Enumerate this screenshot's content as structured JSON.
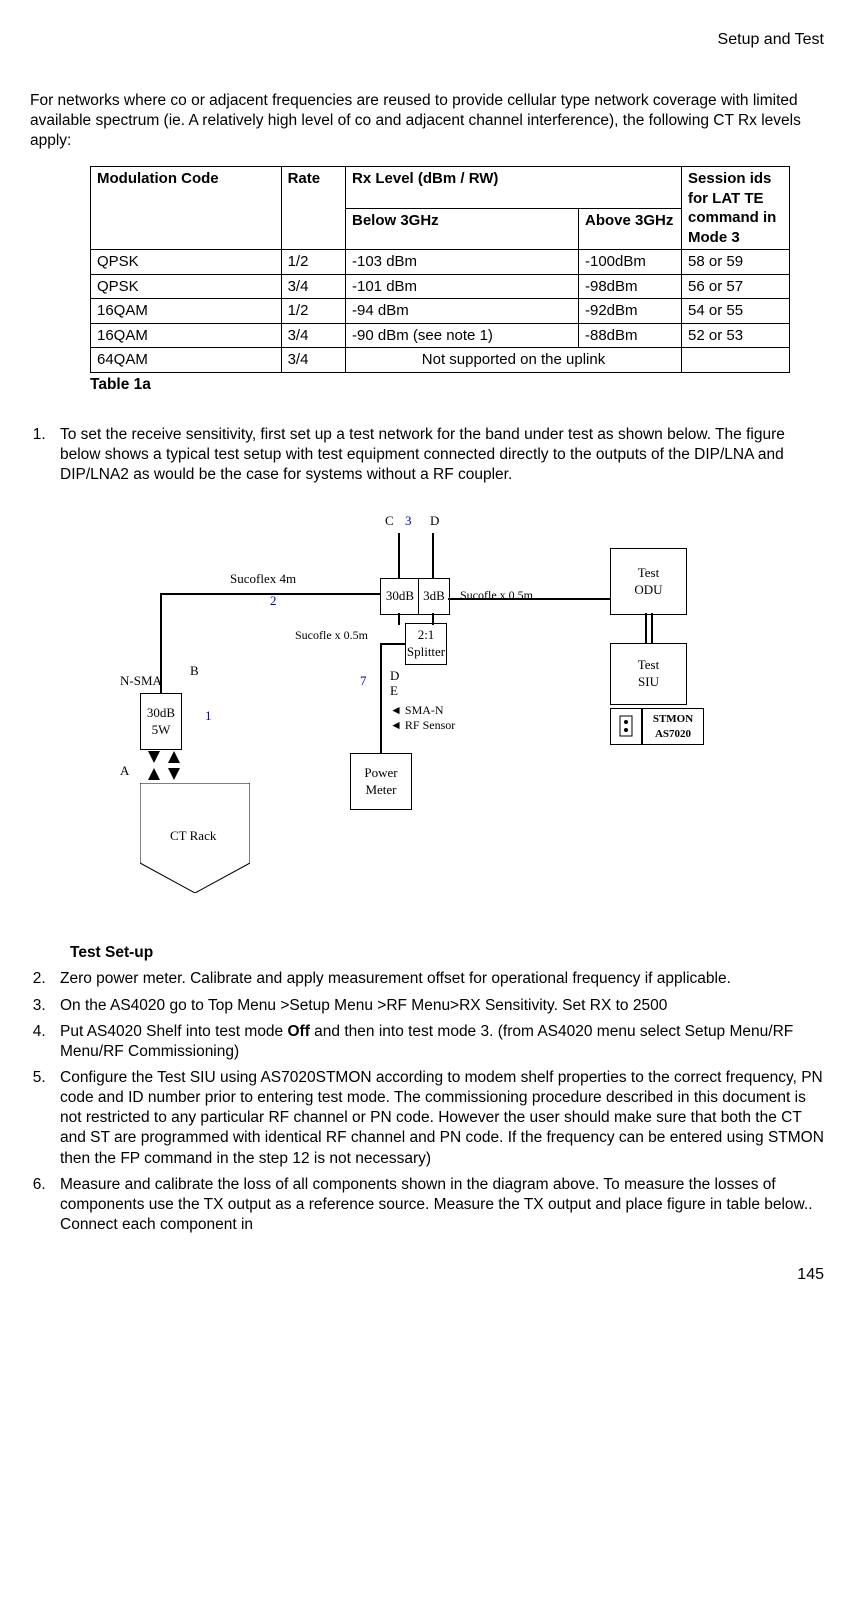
{
  "header": {
    "section": "Setup and Test"
  },
  "intro": "For networks where co or adjacent frequencies are reused to provide cellular type network coverage with limited available spectrum (ie. A relatively high level of co and adjacent channel interference), the following CT Rx levels apply:",
  "table": {
    "headers": {
      "mod": "Modulation Code",
      "rate": "Rate",
      "rx": "Rx Level (dBm / RW)",
      "below": "Below 3GHz",
      "above": "Above 3GHz",
      "session": "Session ids for LAT TE command in Mode 3"
    },
    "rows": [
      {
        "mod": "QPSK",
        "rate": "1/2",
        "below": "-103 dBm",
        "above": "-100dBm",
        "session": "58 or 59"
      },
      {
        "mod": "QPSK",
        "rate": "3/4",
        "below": "-101 dBm",
        "above": "-98dBm",
        "session": "56 or 57"
      },
      {
        "mod": "16QAM",
        "rate": "1/2",
        "below": "-94 dBm",
        "above": "-92dBm",
        "session": "54 or 55"
      },
      {
        "mod": "16QAM",
        "rate": "3/4",
        "below": "-90 dBm (see note 1)",
        "above": "-88dBm",
        "session": "52 or 53"
      },
      {
        "mod": "64QAM",
        "rate": "3/4",
        "below_span": "Not supported on the uplink",
        "session": ""
      }
    ],
    "caption": "Table 1a"
  },
  "diagram": {
    "labels": {
      "A": "A",
      "B": "B",
      "C": "C",
      "D": "D",
      "E": "E",
      "n1": "1",
      "n2": "2",
      "n3": "3",
      "n7": "7",
      "sucoflex4m": "Sucoflex 4m",
      "sucoflex05a": "Sucofle x 0.5m",
      "sucoflex05b": "Sucofle x 0.5m",
      "nsma": "N-SMA",
      "att30w": "30dB\n5W",
      "att30": "30dB",
      "att3": "3dB",
      "splitter": "2:1\nSplitter",
      "sman": "SMA-N",
      "rfsensor": "RF Sensor",
      "powermeter": "Power\nMeter",
      "ctrack": "CT Rack",
      "testodu": "Test\nODU",
      "testsiu": "Test\nSIU",
      "stmon": "STMON\nAS7020"
    }
  },
  "steps": {
    "s1": "To set the receive sensitivity, first set up a test network for the band under test as shown below. The figure below shows a typical test setup with test equipment connected directly to the outputs of the DIP/LNA and DIP/LNA2 as would be the case for systems without a RF coupler.",
    "subhead": "Test Set-up",
    "s2": "Zero power meter. Calibrate and apply measurement offset for operational frequency if applicable.",
    "s3": "On the AS4020 go to Top Menu >Setup Menu >RF Menu>RX Sensitivity. Set RX to 2500",
    "s4_a": "Put AS4020 Shelf into test  mode ",
    "s4_b": "Off",
    "s4_c": " and then into test mode 3. (from AS4020 menu select Setup Menu/RF Menu/RF Commissioning)",
    "s5": "Configure the Test SIU using AS7020STMON according to modem shelf properties to the correct frequency, PN code and ID number  prior to entering test mode. The commissioning procedure described in this document is not restricted to any particular RF channel or PN code. However the user should make sure that both the CT and ST are programmed with identical RF channel and PN code.  If the frequency can be entered using STMON then the FP command in the step 12 is not necessary)",
    "s6": "Measure and calibrate the loss of all components shown in the diagram above. To measure the losses of components use the TX output as a reference source. Measure the TX output and place figure in table below.. Connect each  component in"
  },
  "footer": {
    "page": "145"
  }
}
